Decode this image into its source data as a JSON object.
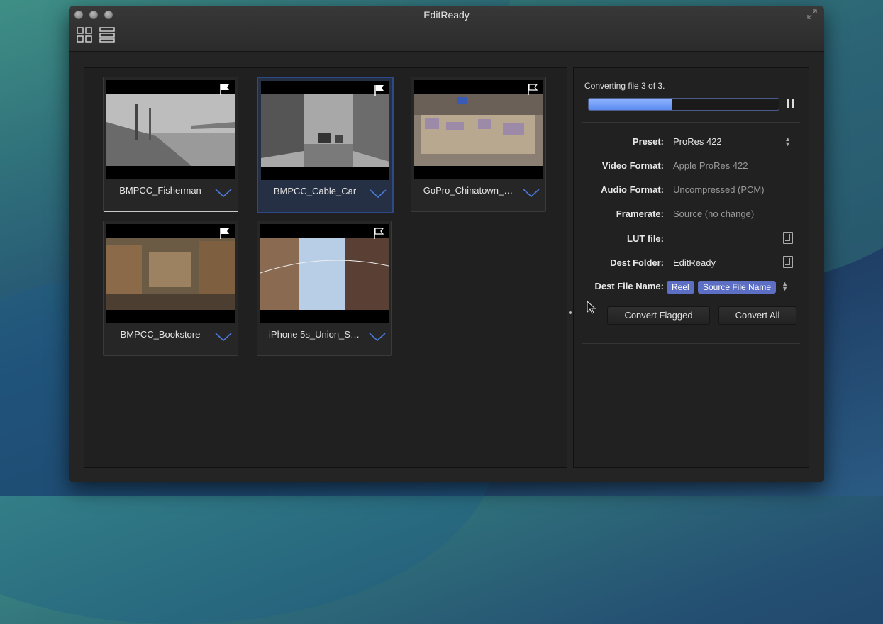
{
  "window": {
    "title": "EditReady"
  },
  "toolbar": {
    "grid_view": "grid-view-icon",
    "list_view": "list-view-icon"
  },
  "clips": [
    {
      "name": "BMPCC_Fisherman",
      "flagged": true,
      "selected": false
    },
    {
      "name": "BMPCC_Cable_Car",
      "flagged": true,
      "selected": true
    },
    {
      "name": "GoPro_Chinatown_…",
      "flagged": false,
      "selected": false
    },
    {
      "name": "BMPCC_Bookstore",
      "flagged": true,
      "selected": false
    },
    {
      "name": "iPhone 5s_Union_S…",
      "flagged": false,
      "selected": false
    }
  ],
  "conversion": {
    "status": "Converting file 3 of 3.",
    "progress": 0.44
  },
  "settings": {
    "preset_label": "Preset:",
    "preset_value": "ProRes 422",
    "video_format_label": "Video Format:",
    "video_format_value": "Apple ProRes 422",
    "audio_format_label": "Audio Format:",
    "audio_format_value": "Uncompressed (PCM)",
    "framerate_label": "Framerate:",
    "framerate_value": "Source (no change)",
    "lut_label": "LUT file:",
    "dest_folder_label": "Dest Folder:",
    "dest_folder_value": "EditReady",
    "dest_file_name_label": "Dest File Name:",
    "dest_file_name_tokens": [
      "Reel",
      "Source File Name"
    ]
  },
  "actions": {
    "convert_flagged": "Convert Flagged",
    "convert_all": "Convert All"
  },
  "colors": {
    "accent": "#5d8cf0",
    "token": "#5c6fc4",
    "selection": "#2e4a86"
  }
}
